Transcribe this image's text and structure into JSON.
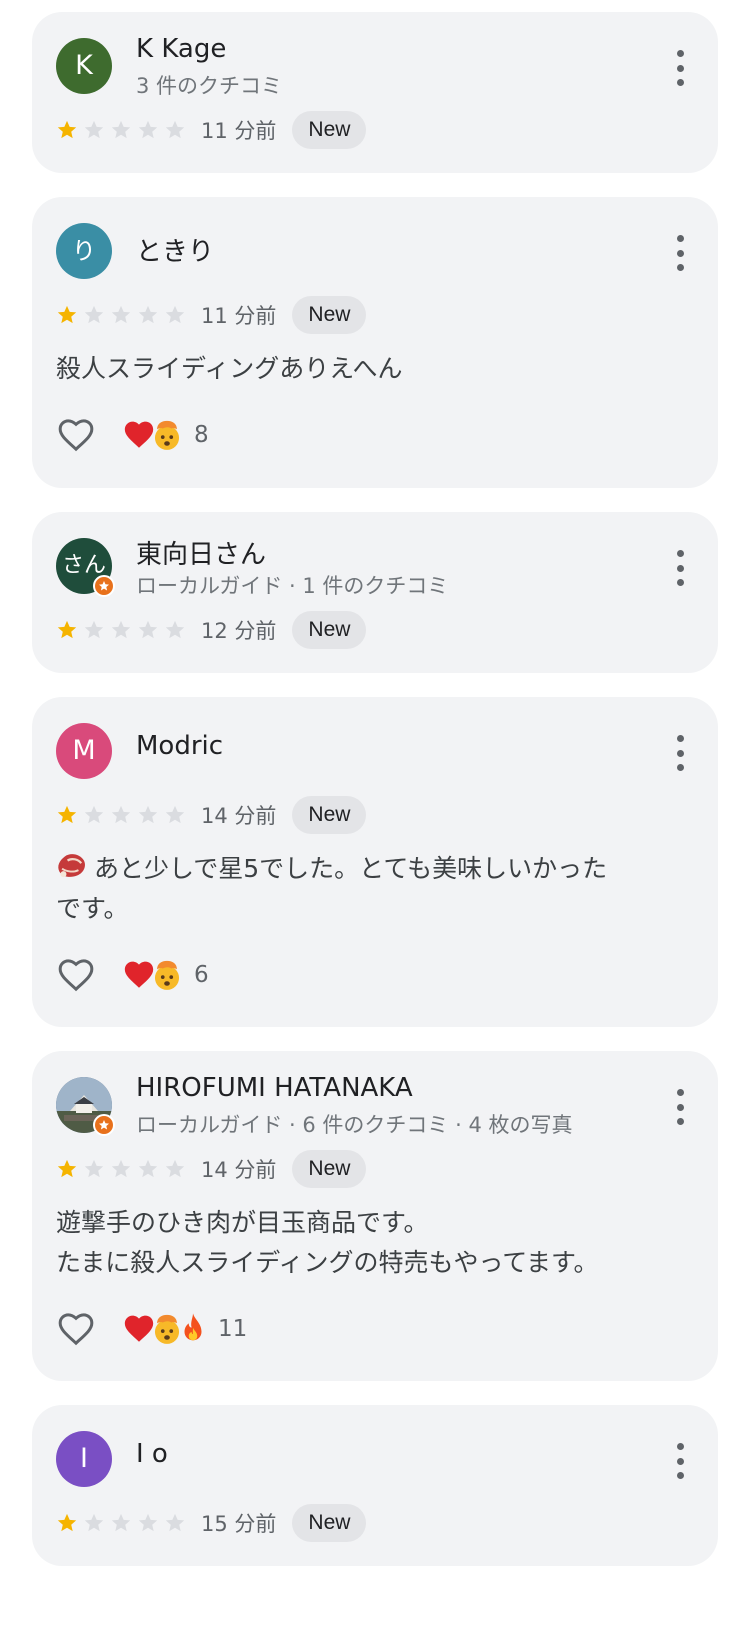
{
  "reviews": [
    {
      "avatar_letter": "K",
      "avatar_color": "#3e6b2e",
      "name": "K Kage",
      "meta": "3 件のクチコミ",
      "rating": 1,
      "time": "11 分前",
      "badge": "New"
    },
    {
      "avatar_letter": "り",
      "avatar_color": "#3a8ea5",
      "name": "ときり",
      "meta": "",
      "rating": 1,
      "time": "11 分前",
      "badge": "New",
      "text": [
        "殺人スライディングありえへん"
      ],
      "reaction_emojis": [
        "heart-emoji",
        "exploding-head-emoji"
      ],
      "reaction_count": "8"
    },
    {
      "avatar_letter": "さん",
      "avatar_color": "#1f4d3b",
      "name": "東向日さん",
      "meta": "ローカルガイド · 1 件のクチコミ",
      "rating": 1,
      "time": "12 分前",
      "badge": "New"
    },
    {
      "avatar_letter": "M",
      "avatar_color": "#d94a7b",
      "name": "Modric",
      "meta": "",
      "rating": 1,
      "time": "14 分前",
      "badge": "New",
      "text": [
        "あと少しで星5でした。とても美味しいかった",
        "です。"
      ],
      "text_leading_emoji": "meat-emoji",
      "reaction_emojis": [
        "heart-emoji",
        "exploding-head-emoji"
      ],
      "reaction_count": "6"
    },
    {
      "avatar_letter": "",
      "avatar_color": "#6b7f99",
      "name": "HIROFUMI HATANAKA",
      "meta": "ローカルガイド · 6 件のクチコミ · 4 枚の写真",
      "rating": 1,
      "time": "14 分前",
      "badge": "New",
      "text": [
        "遊撃手のひき肉が目玉商品です。",
        "たまに殺人スライディングの特売もやってます。"
      ],
      "reaction_emojis": [
        "heart-emoji",
        "exploding-head-emoji",
        "fire-emoji"
      ],
      "reaction_count": "11"
    },
    {
      "avatar_letter": "I",
      "avatar_color": "#7a4fc4",
      "name": "I o",
      "meta": "",
      "rating": 1,
      "time": "15 分前",
      "badge": "New"
    }
  ],
  "colors": {
    "star_filled": "#f5b400",
    "star_empty": "#dadce0",
    "card_bg": "#f2f3f5"
  }
}
